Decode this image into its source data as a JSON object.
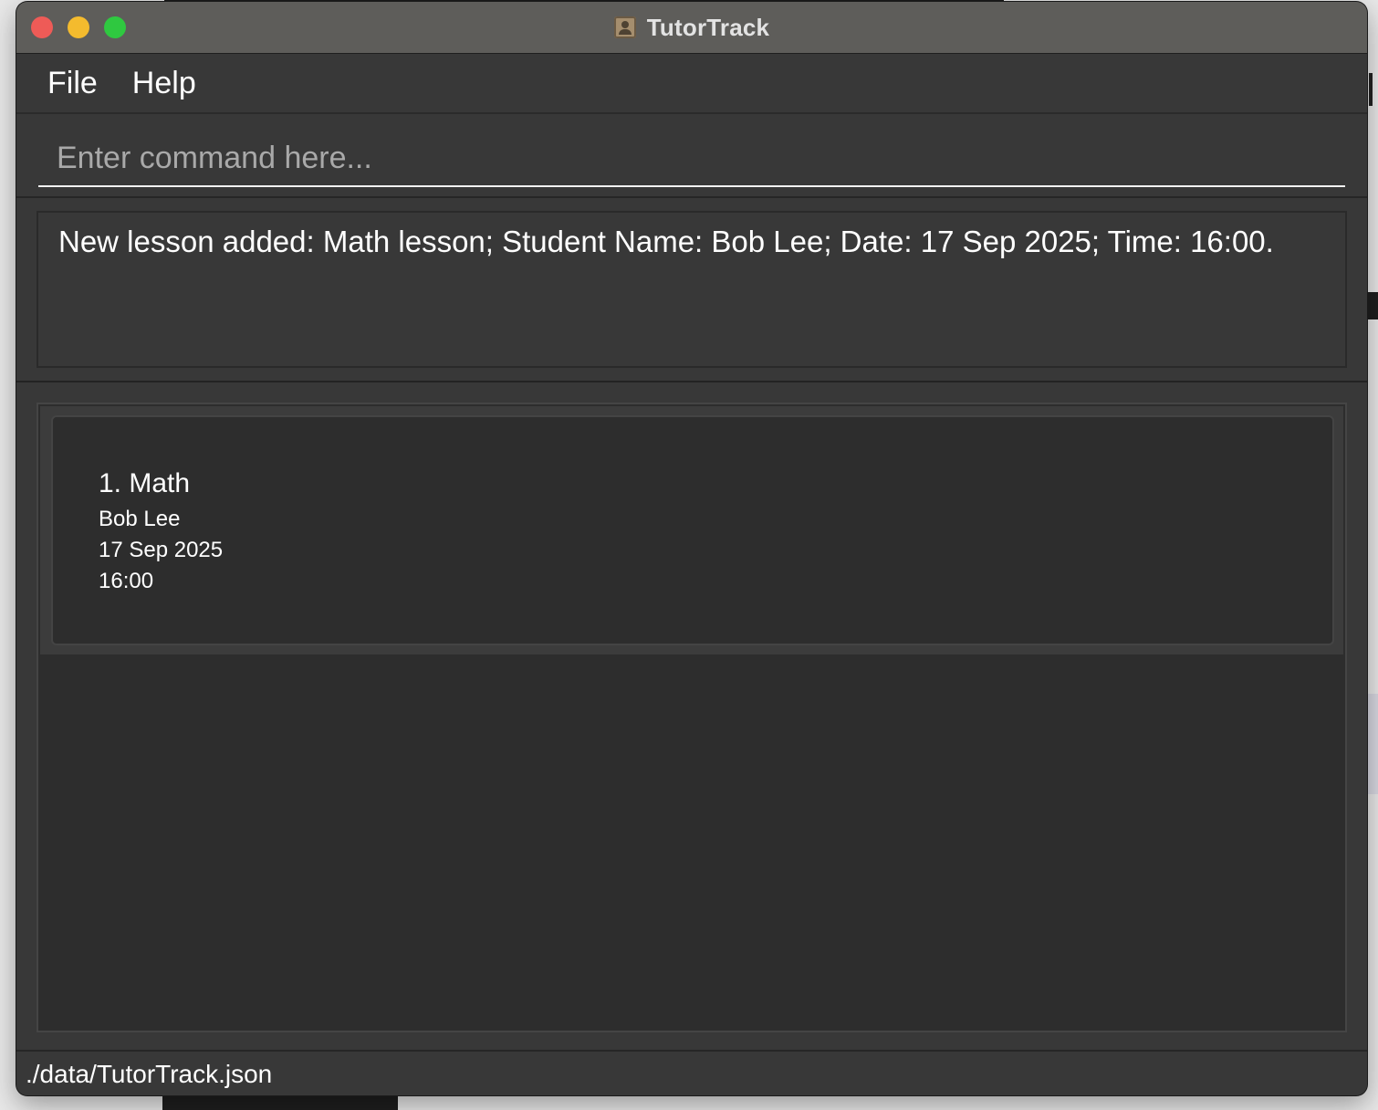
{
  "window": {
    "title": "TutorTrack"
  },
  "menu": {
    "items": [
      {
        "label": "File"
      },
      {
        "label": "Help"
      }
    ]
  },
  "command": {
    "value": "",
    "placeholder": "Enter command here..."
  },
  "result": {
    "message": "New lesson added: Math lesson; Student Name: Bob Lee; Date: 17 Sep 2025; Time: 16:00."
  },
  "lessons": [
    {
      "title": "1. Math",
      "student": "Bob Lee",
      "date": "17 Sep 2025",
      "time": "16:00"
    }
  ],
  "status": {
    "path": "./data/TutorTrack.json"
  },
  "colors": {
    "close": "#ee5b57",
    "minimize": "#f4bb2e",
    "maximize": "#2fc840",
    "panel": "#383838",
    "list_background": "#2d2d2d"
  }
}
